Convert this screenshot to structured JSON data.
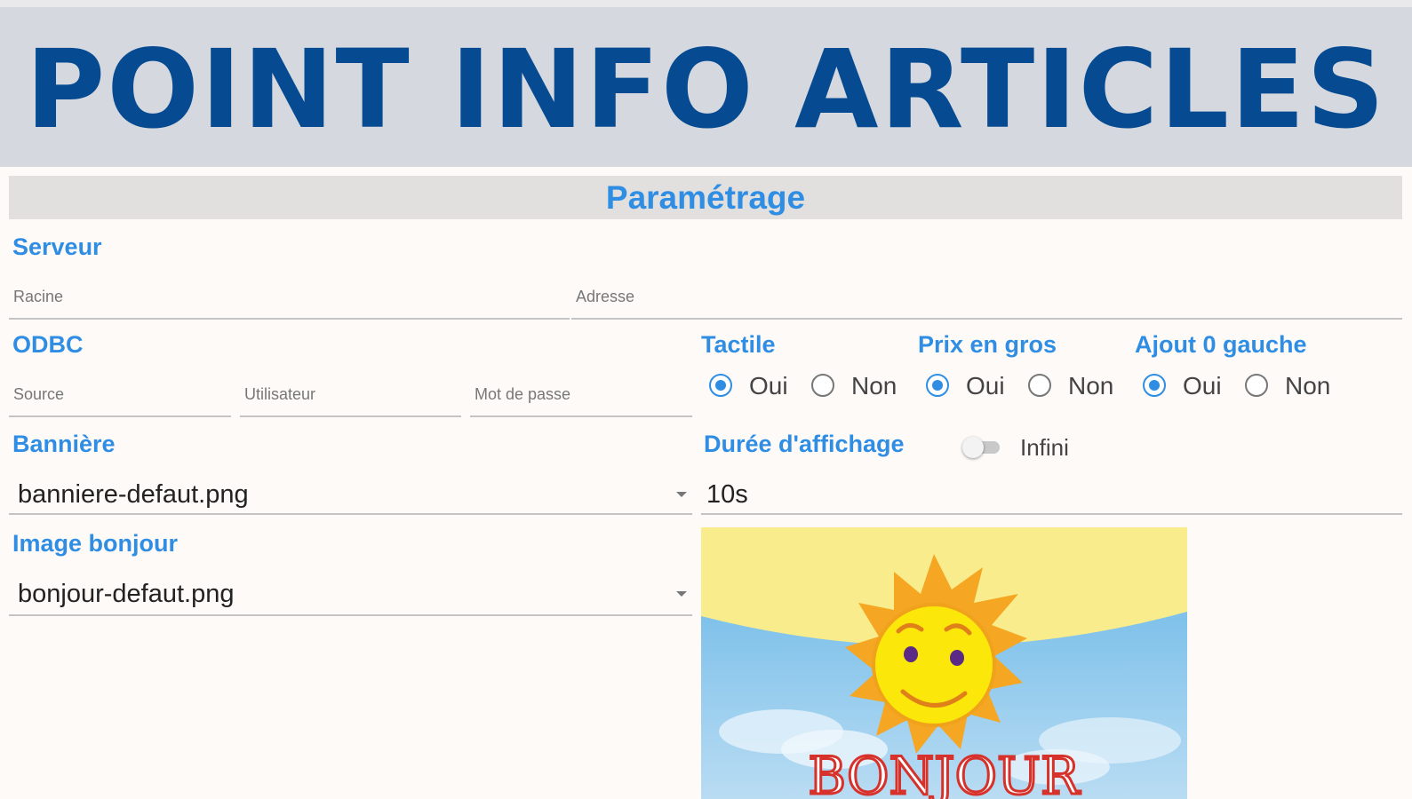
{
  "banner": {
    "title": "POINT INFO ARTICLES"
  },
  "section": {
    "title": "Paramétrage"
  },
  "serveur": {
    "label": "Serveur",
    "racine_placeholder": "Racine",
    "adresse_placeholder": "Adresse"
  },
  "odbc": {
    "label": "ODBC",
    "source_placeholder": "Source",
    "utilisateur_placeholder": "Utilisateur",
    "mot_de_passe_placeholder": "Mot de passe"
  },
  "tactile": {
    "label": "Tactile",
    "options": [
      "Oui",
      "Non"
    ],
    "selected": "Oui"
  },
  "prix_en_gros": {
    "label": "Prix en gros",
    "options": [
      "Oui",
      "Non"
    ],
    "selected": "Oui"
  },
  "ajout_0_gauche": {
    "label": "Ajout 0 gauche",
    "options": [
      "Oui",
      "Non"
    ],
    "selected": "Oui"
  },
  "banniere": {
    "label": "Bannière",
    "selected_value": "banniere-defaut.png"
  },
  "duree_affichage": {
    "label": "Durée d'affichage",
    "toggle_label": "Infini",
    "toggle_on": false,
    "value": "10s"
  },
  "image_bonjour": {
    "label": "Image bonjour",
    "selected_value": "bonjour-defaut.png",
    "preview_text": "BONJOUR"
  },
  "colors": {
    "accent": "#2f8ee3",
    "banner_text": "#064b92",
    "banner_bg": "#d5d8de"
  }
}
